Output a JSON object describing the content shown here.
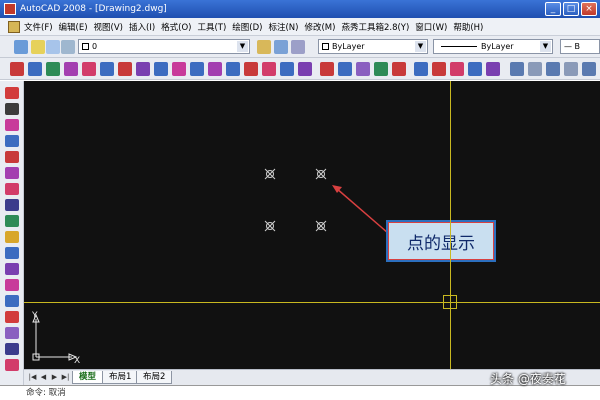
{
  "window": {
    "title": "AutoCAD 2008 - [Drawing2.dwg]",
    "min": "_",
    "max": "□",
    "close": "×"
  },
  "menubar": {
    "items": [
      "文件(F)",
      "编辑(E)",
      "视图(V)",
      "插入(I)",
      "格式(O)",
      "工具(T)",
      "绘图(D)",
      "标注(N)",
      "修改(M)",
      "燕秀工具箱2.8(Y)",
      "窗口(W)",
      "帮助(H)"
    ]
  },
  "toolbar": {
    "layer_value": "0",
    "color_value": "ByLayer",
    "linetype_value": "ByLayer",
    "lineweight_value": "— B"
  },
  "canvas": {
    "annotation": "点的显示",
    "ucs_x": "X",
    "ucs_y": "Y"
  },
  "tabs": {
    "model": "模型",
    "layout1": "布局1",
    "layout2": "布局2"
  },
  "command": {
    "text": "命令:  取消"
  },
  "watermark": "头条 @夜奏花",
  "colors": {
    "crosshair": "#c8b820",
    "canvas": "#111111",
    "callout_bg": "#c9dff0",
    "callout_border": "#2c6fbe",
    "arrow": "#d84040"
  }
}
